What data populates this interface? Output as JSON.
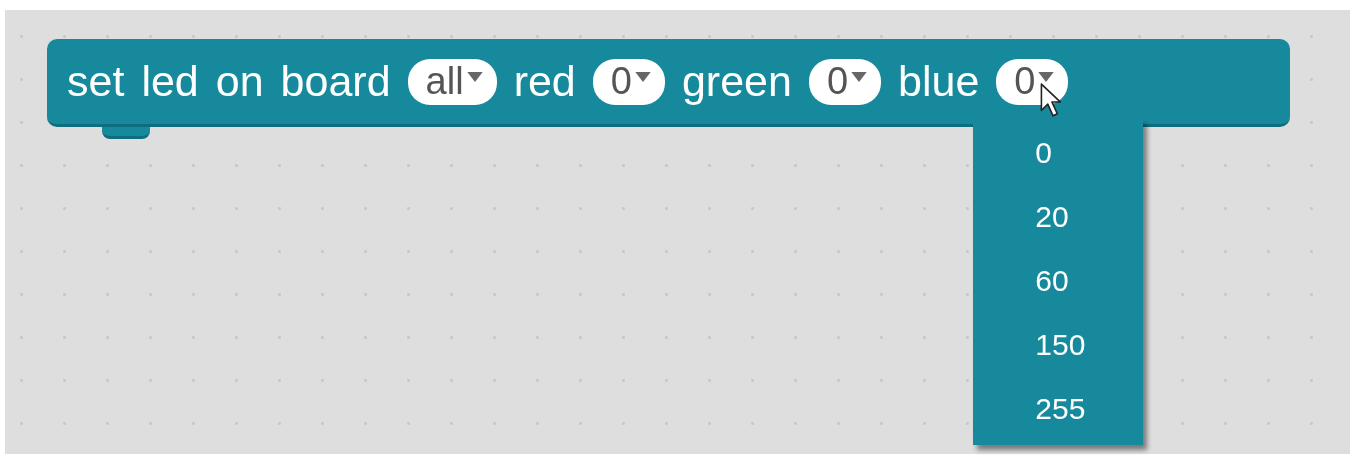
{
  "block": {
    "parts": [
      {
        "kind": "label",
        "text": "set"
      },
      {
        "kind": "label",
        "text": "led"
      },
      {
        "kind": "label",
        "text": "on"
      },
      {
        "kind": "label",
        "text": "board"
      },
      {
        "kind": "dropdown",
        "value": "all",
        "open": false
      },
      {
        "kind": "label",
        "text": "red"
      },
      {
        "kind": "dropdown",
        "value": "0",
        "open": false
      },
      {
        "kind": "label",
        "text": "green"
      },
      {
        "kind": "dropdown",
        "value": "0",
        "open": false
      },
      {
        "kind": "label",
        "text": "blue"
      },
      {
        "kind": "dropdown",
        "value": "0",
        "open": true
      }
    ]
  },
  "menu": {
    "options": [
      "0",
      "20",
      "60",
      "150",
      "255"
    ]
  }
}
